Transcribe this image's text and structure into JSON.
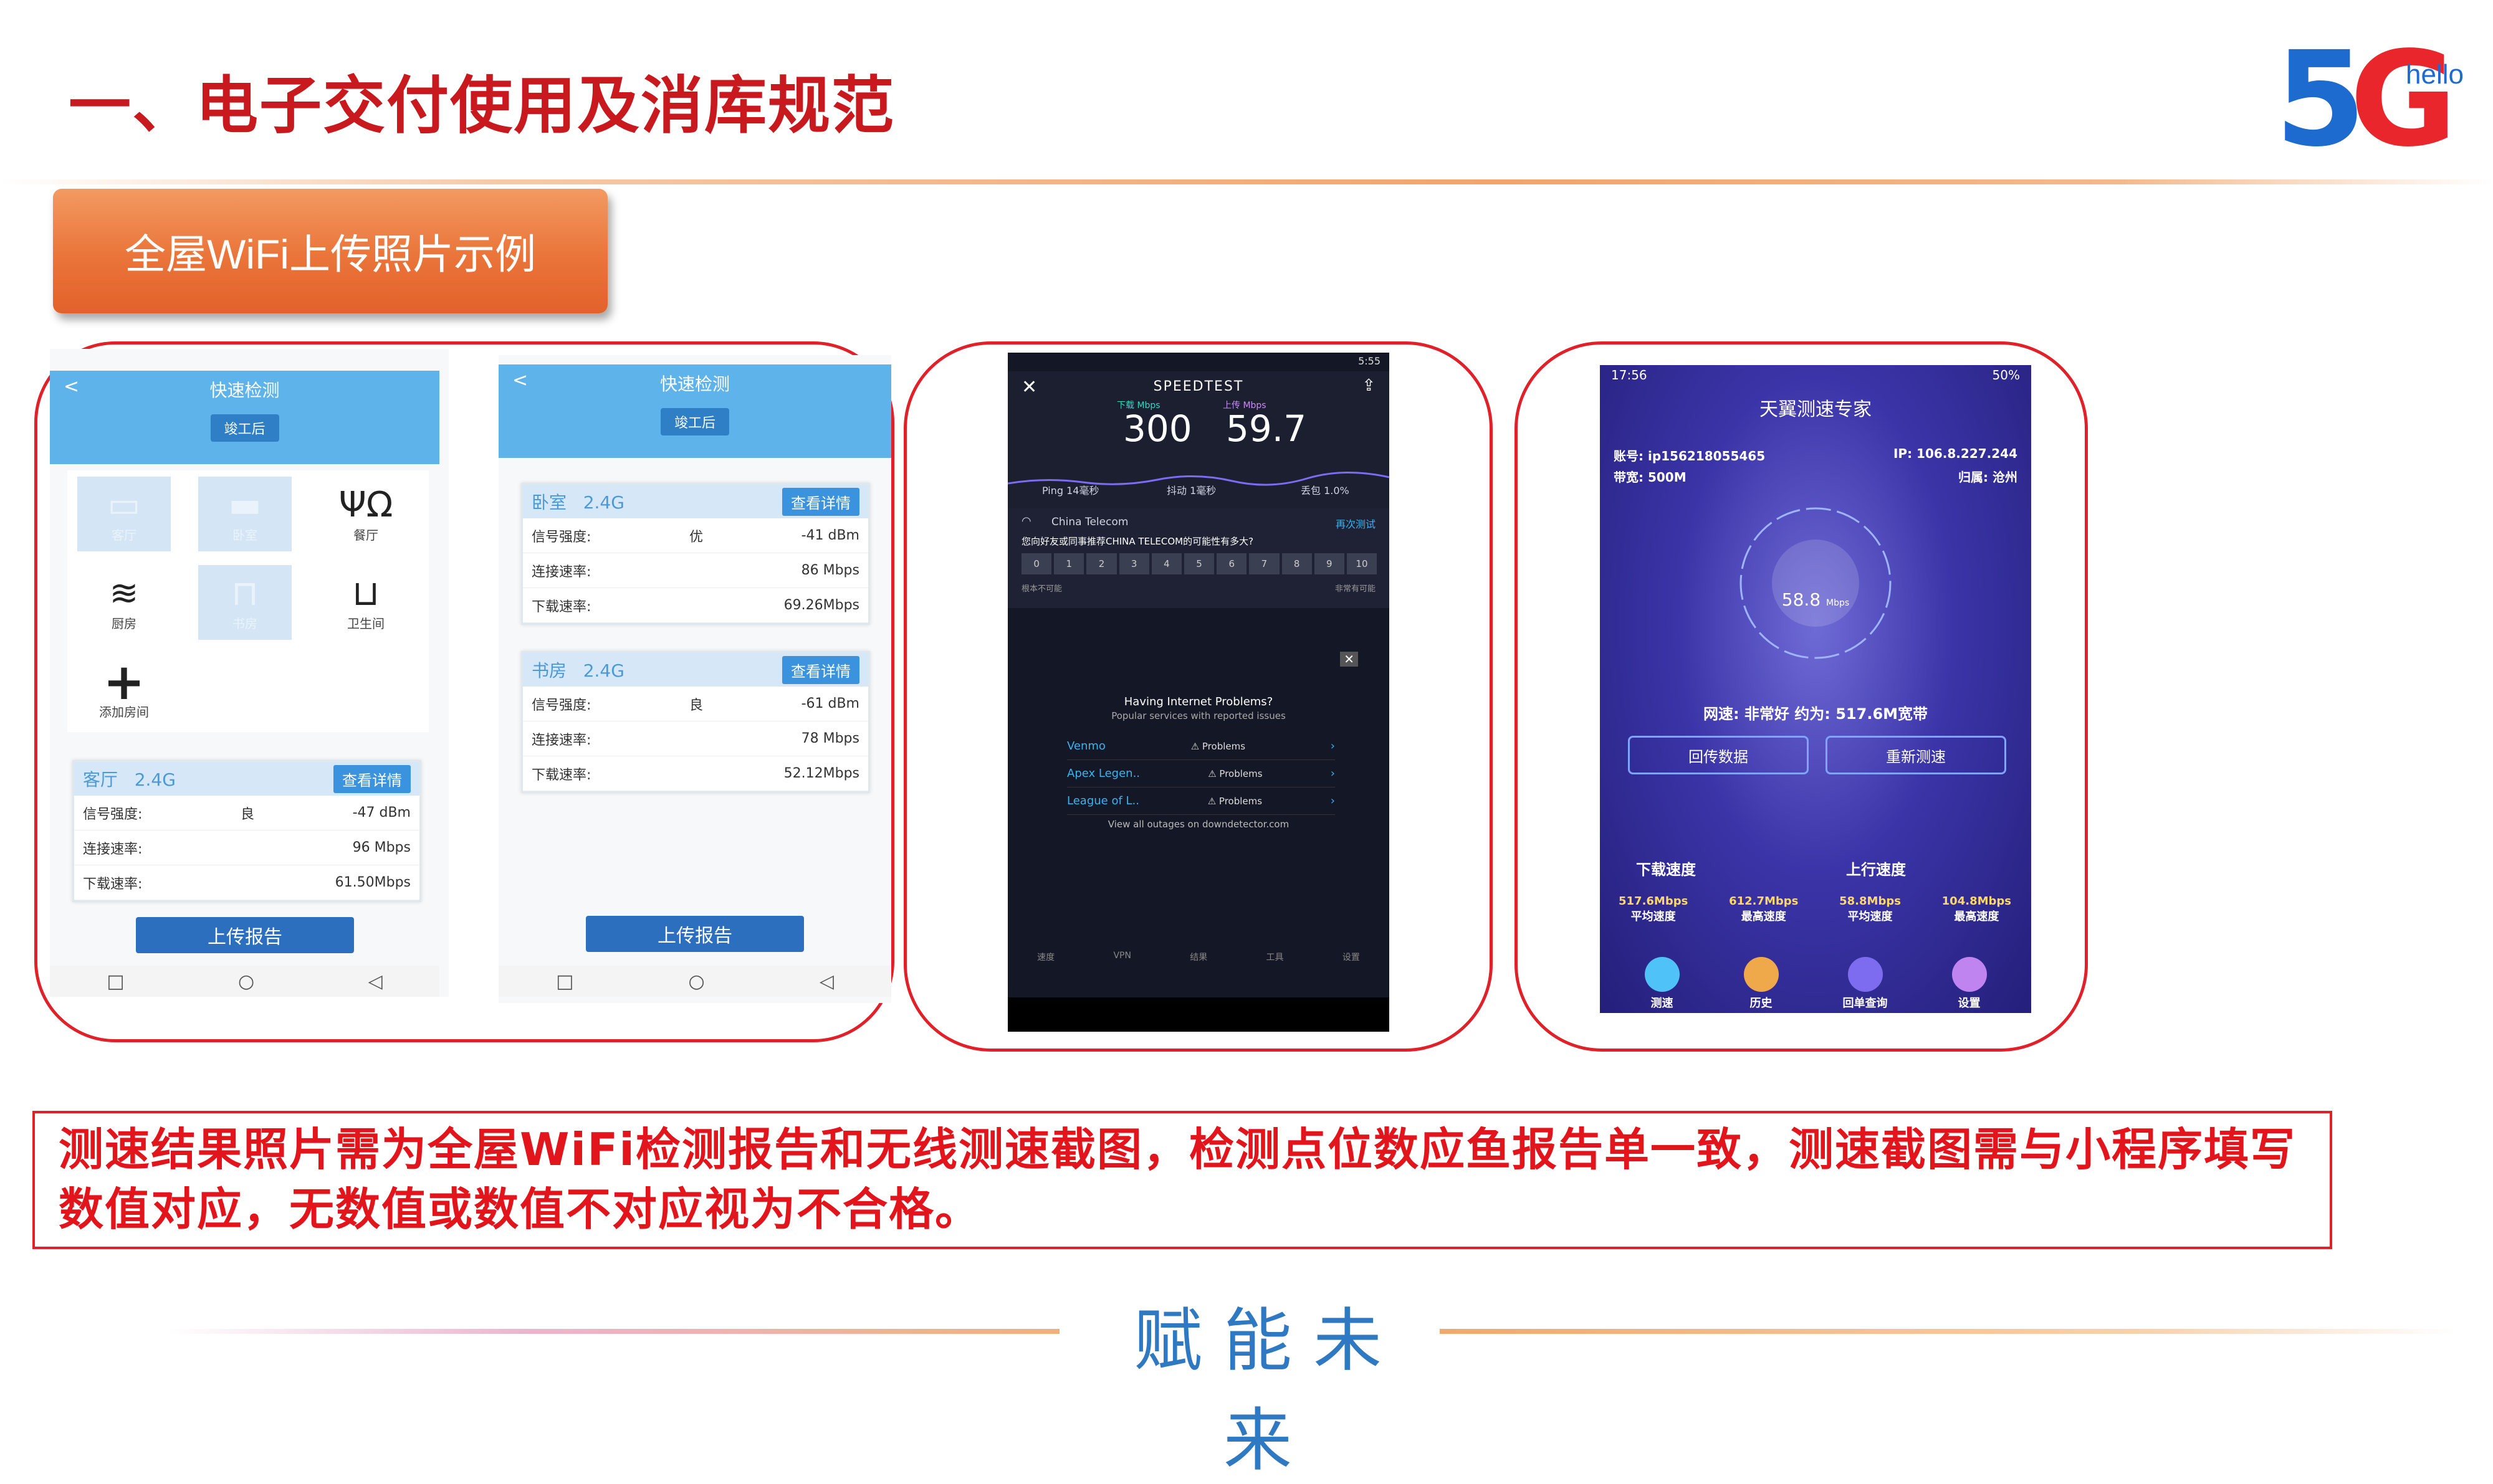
{
  "header": {
    "title": "一、电子交付使用及消库规范",
    "logo_text": "5G",
    "logo_hello": "hello",
    "section_label": "全屋WiFi上传照片示例"
  },
  "wifi_left": {
    "title": "快速检测",
    "back": "<",
    "pill": "竣工后",
    "rooms": [
      {
        "label": "客厅",
        "icon": "sofa-icon",
        "glyph": "🛋",
        "dim": true
      },
      {
        "label": "卧室",
        "icon": "bed-icon",
        "glyph": "🛏",
        "dim": true
      },
      {
        "label": "餐厅",
        "icon": "dining-icon",
        "glyph": "🍴",
        "dim": false
      },
      {
        "label": "厨房",
        "icon": "kitchen-icon",
        "glyph": "♨",
        "dim": false
      },
      {
        "label": "书房",
        "icon": "desk-icon",
        "glyph": "▭",
        "dim": true
      },
      {
        "label": "卫生间",
        "icon": "bath-icon",
        "glyph": "🛁",
        "dim": false
      },
      {
        "label": "添加房间",
        "icon": "add-icon",
        "glyph": "+",
        "dim": false
      }
    ],
    "card": {
      "room": "客厅",
      "band": "2.4G",
      "details_btn": "查看详情",
      "rows": [
        {
          "k": "信号强度:",
          "q": "良",
          "v": "-47 dBm"
        },
        {
          "k": "连接速率:",
          "q": "",
          "v": "96 Mbps"
        },
        {
          "k": "下载速率:",
          "q": "",
          "v": "61.50Mbps"
        }
      ]
    },
    "upload": "上传报告"
  },
  "wifi_right": {
    "title": "快速检测",
    "back": "<",
    "pill": "竣工后",
    "cards": [
      {
        "room": "卧室",
        "band": "2.4G",
        "details_btn": "查看详情",
        "rows": [
          {
            "k": "信号强度:",
            "q": "优",
            "v": "-41 dBm"
          },
          {
            "k": "连接速率:",
            "q": "",
            "v": "86 Mbps"
          },
          {
            "k": "下载速率:",
            "q": "",
            "v": "69.26Mbps"
          }
        ]
      },
      {
        "room": "书房",
        "band": "2.4G",
        "details_btn": "查看详情",
        "rows": [
          {
            "k": "信号强度:",
            "q": "良",
            "v": "-61 dBm"
          },
          {
            "k": "连接速率:",
            "q": "",
            "v": "78 Mbps"
          },
          {
            "k": "下载速率:",
            "q": "",
            "v": "52.12Mbps"
          }
        ]
      }
    ],
    "upload": "上传报告"
  },
  "nav_glyphs": [
    "□",
    "○",
    "◁"
  ],
  "speedtest": {
    "status_time": "5:55",
    "brand": "SPEEDTEST",
    "download_label": "下载 Mbps",
    "upload_label": "上传 Mbps",
    "download": "300",
    "upload": "59.7",
    "ping": "Ping 14毫秒",
    "jitter": "抖动 1毫秒",
    "loss": "丢包 1.0%",
    "isp": "China Telecom",
    "retest": "再次测试",
    "question": "您向好友或同事推荐CHINA TELECOM的可能性有多大?",
    "scale": [
      "0",
      "1",
      "2",
      "3",
      "4",
      "5",
      "6",
      "7",
      "8",
      "9",
      "10"
    ],
    "scale_low": "根本不可能",
    "scale_high": "非常有可能",
    "problems_title": "Having Internet Problems?",
    "problems_sub": "Popular services with reported issues",
    "services": [
      {
        "name": "Venmo",
        "status": "Problems"
      },
      {
        "name": "Apex Legen..",
        "status": "Problems"
      },
      {
        "name": "League of L..",
        "status": "Problems"
      }
    ],
    "footer": "View all outages on downdetector.com",
    "tabs": [
      "速度",
      "VPN",
      "结果",
      "工具",
      "设置"
    ]
  },
  "tianyi": {
    "status_time": "17:56",
    "battery": "50%",
    "title": "天翼测速专家",
    "account": "账号: ip156218055465",
    "bandwidth": "带宽: 500M",
    "ip": "IP: 106.8.227.244",
    "region": "归属: 沧州",
    "speed": "58.8",
    "speed_unit": "Mbps",
    "verdict": "网速: 非常好 约为: 517.6M宽带",
    "btn_return": "回传数据",
    "btn_retest": "重新测速",
    "download_title": "下载速度",
    "upload_title": "上行速度",
    "stats": [
      {
        "v": "517.6Mbps",
        "l": "平均速度"
      },
      {
        "v": "612.7Mbps",
        "l": "最高速度"
      },
      {
        "v": "58.8Mbps",
        "l": "平均速度"
      },
      {
        "v": "104.8Mbps",
        "l": "最高速度"
      }
    ],
    "tabs": [
      "测速",
      "历史",
      "回单查询",
      "设置"
    ]
  },
  "caption": "测速结果照片需为全屋WiFi检测报告和无线测速截图，检测点位数应鱼报告单一致，测速截图需与小程序填写数值对应，无数值或数值不对应视为不合格。",
  "footer": "赋能未来",
  "colors": {
    "title_red": "#c8191e",
    "frame_red": "#e0212a",
    "footer_blue": "#2e79c2",
    "label_orange": "#ea7439"
  }
}
